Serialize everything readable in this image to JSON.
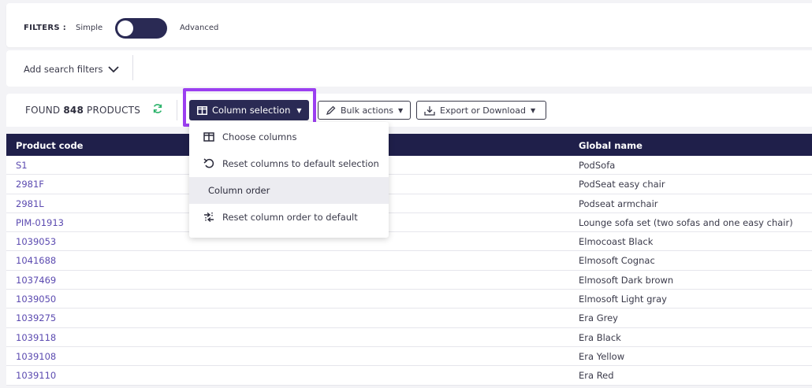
{
  "filters": {
    "label": "FILTERS :",
    "simple_label": "Simple",
    "advanced_label": "Advanced"
  },
  "search": {
    "add_filters_label": "Add search filters"
  },
  "toolbar": {
    "found_prefix": "FOUND",
    "found_count": "848",
    "found_suffix": "PRODUCTS",
    "column_selection_label": "Column selection",
    "bulk_actions_label": "Bulk actions",
    "export_label": "Export or Download"
  },
  "dropdown": {
    "items": [
      {
        "label": "Choose columns",
        "icon": "columns-icon"
      },
      {
        "label": "Reset columns to default selection",
        "icon": "undo-icon"
      },
      {
        "label": "Column order",
        "icon": ""
      },
      {
        "label": "Reset column order to default",
        "icon": "reorder-icon"
      }
    ]
  },
  "table": {
    "columns": [
      "Product code",
      "Global name"
    ],
    "rows": [
      {
        "code": "S1",
        "global_name": "PodSofa"
      },
      {
        "code": "2981F",
        "global_name": "PodSeat easy chair"
      },
      {
        "code": "2981L",
        "global_name": "Podseat armchair"
      },
      {
        "code": "PIM-01913",
        "global_name": "Lounge sofa set (two sofas and one easy chair)"
      },
      {
        "code": "1039053",
        "global_name": "Elmocoast Black"
      },
      {
        "code": "1041688",
        "global_name": "Elmosoft Cognac"
      },
      {
        "code": "1037469",
        "global_name": "Elmosoft Dark brown"
      },
      {
        "code": "1039050",
        "global_name": "Elmosoft Light gray"
      },
      {
        "code": "1039275",
        "global_name": "Era Grey"
      },
      {
        "code": "1039118",
        "global_name": "Era Black"
      },
      {
        "code": "1039108",
        "global_name": "Era Yellow"
      },
      {
        "code": "1039110",
        "global_name": "Era Red"
      }
    ]
  },
  "colors": {
    "primary": "#2a2a54",
    "header_bg": "#1f1f4a",
    "link": "#5b4ab0",
    "highlight": "#9b3ff0"
  }
}
